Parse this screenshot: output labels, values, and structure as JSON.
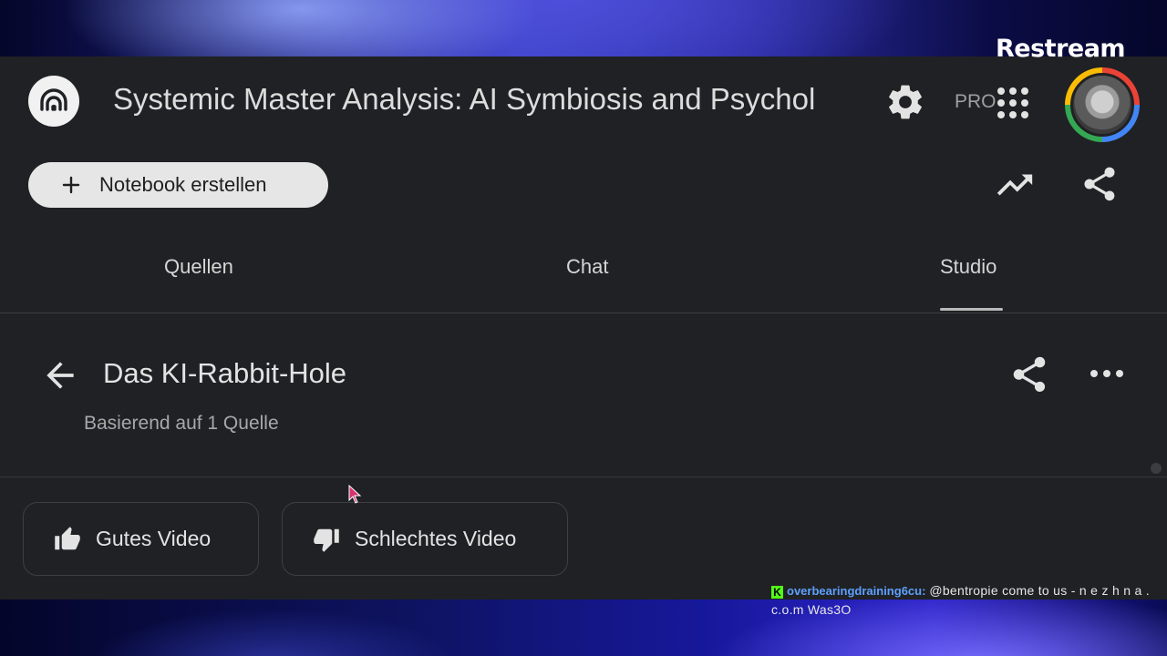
{
  "overlay": {
    "brand": "Restream",
    "chat": {
      "platform_badge": "K",
      "username": "overbearingdraining6cu:",
      "message": "@bentropie come to us - n e z h n a . c.o.m Was3O"
    }
  },
  "header": {
    "notebook_title": "Systemic Master Analysis: AI Symbiosis and Psychol",
    "pro_label": "PRO",
    "create_notebook_label": "Notebook erstellen"
  },
  "tabs": [
    {
      "label": "Quellen",
      "active": false
    },
    {
      "label": "Chat",
      "active": false
    },
    {
      "label": "Studio",
      "active": true
    }
  ],
  "studio": {
    "audio_title": "Das KI-Rabbit-Hole",
    "audio_subtitle": "Basierend auf 1 Quelle",
    "feedback_good": "Gutes Video",
    "feedback_bad": "Schlechtes Video"
  },
  "colors": {
    "app_bg": "#202124",
    "button_bg": "#e6e6e6",
    "chat_username": "#5da0ff",
    "kick_green": "#53fc18"
  }
}
